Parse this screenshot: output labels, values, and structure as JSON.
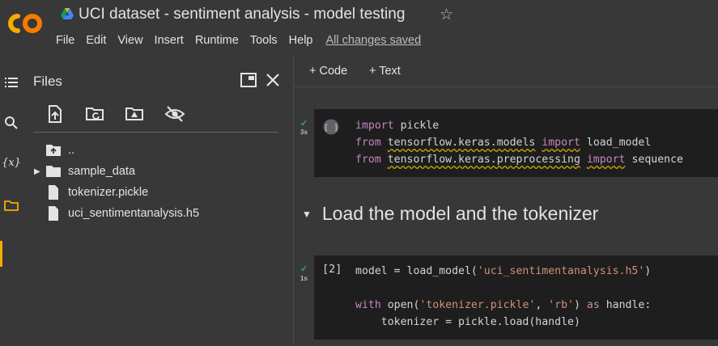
{
  "header": {
    "title": "UCI dataset - sentiment analysis - model testing",
    "star_glyph": "☆",
    "logo_text": "CO",
    "menu": [
      "File",
      "Edit",
      "View",
      "Insert",
      "Runtime",
      "Tools",
      "Help"
    ],
    "saved_status": "All changes saved"
  },
  "rail": {
    "icons": [
      "toc-icon",
      "search-icon",
      "variables-icon",
      "folder-icon"
    ],
    "variables_label": "{x}"
  },
  "files": {
    "title": "Files",
    "toolbar": [
      "upload-icon",
      "refresh-folder-icon",
      "drive-mount-icon",
      "hide-files-icon"
    ],
    "tree": [
      {
        "label": "..",
        "type": "parent"
      },
      {
        "label": "sample_data",
        "type": "folder"
      },
      {
        "label": "tokenizer.pickle",
        "type": "file"
      },
      {
        "label": "uci_sentimentanalysis.h5",
        "type": "file"
      }
    ]
  },
  "notebook": {
    "toolbar": {
      "code_label": "+ Code",
      "text_label": "+ Text"
    },
    "cell1": {
      "duration": "3s",
      "lines": [
        [
          {
            "t": "import",
            "c": "kw"
          },
          {
            "t": " pickle"
          }
        ],
        [
          {
            "t": "from",
            "c": "kw"
          },
          {
            "t": " "
          },
          {
            "t": "tensorflow.keras.models",
            "c": "sq"
          },
          {
            "t": " "
          },
          {
            "t": "import",
            "c": "kw sq"
          },
          {
            "t": " load_model"
          }
        ],
        [
          {
            "t": "from",
            "c": "kw"
          },
          {
            "t": " "
          },
          {
            "t": "tensorflow.keras.preprocessing",
            "c": "sq"
          },
          {
            "t": " "
          },
          {
            "t": "import",
            "c": "kw sq"
          },
          {
            "t": " sequence"
          }
        ]
      ]
    },
    "section_title": "Load the model and the tokenizer",
    "cell2": {
      "exec_count": "[2]",
      "duration": "1s",
      "lines": [
        [
          {
            "t": "model = load_model("
          },
          {
            "t": "'uci_sentimentanalysis.h5'",
            "c": "str"
          },
          {
            "t": ")"
          }
        ],
        [
          {
            "t": ""
          }
        ],
        [
          {
            "t": "with",
            "c": "kw"
          },
          {
            "t": " open("
          },
          {
            "t": "'tokenizer.pickle'",
            "c": "str"
          },
          {
            "t": ", "
          },
          {
            "t": "'rb'",
            "c": "str"
          },
          {
            "t": ") "
          },
          {
            "t": "as",
            "c": "kw"
          },
          {
            "t": " handle:"
          }
        ],
        [
          {
            "t": "    tokenizer = pickle.load(handle)"
          }
        ]
      ]
    }
  },
  "colors": {
    "background": "#383838",
    "cell_bg": "#1e1e1e",
    "keyword": "#c586c0",
    "string": "#ce9178",
    "success": "#34a853",
    "accent": "#f9ab00"
  }
}
